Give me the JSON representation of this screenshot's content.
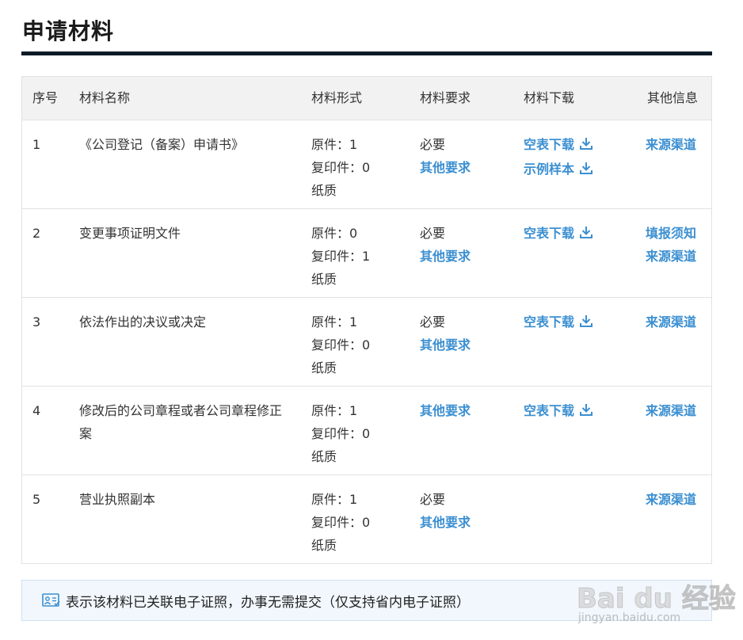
{
  "page": {
    "title": "申请材料"
  },
  "table": {
    "headers": {
      "no": "序号",
      "name": "材料名称",
      "form": "材料形式",
      "req": "材料要求",
      "download": "材料下载",
      "info": "其他信息"
    },
    "rows": [
      {
        "no": "1",
        "name": "《公司登记（备案）申请书》",
        "form": [
          "原件：1",
          "复印件：0",
          "纸质"
        ],
        "req_text": "必要",
        "req_link": "其他要求",
        "downloads": [
          "空表下载",
          "示例样本"
        ],
        "info_links": [
          "来源渠道"
        ]
      },
      {
        "no": "2",
        "name": "变更事项证明文件",
        "form": [
          "原件：0",
          "复印件：1",
          "纸质"
        ],
        "req_text": "必要",
        "req_link": "其他要求",
        "downloads": [
          "空表下载"
        ],
        "info_links": [
          "填报须知",
          "来源渠道"
        ]
      },
      {
        "no": "3",
        "name": "依法作出的决议或决定",
        "form": [
          "原件：1",
          "复印件：0",
          "纸质"
        ],
        "req_text": "必要",
        "req_link": "其他要求",
        "downloads": [
          "空表下载"
        ],
        "info_links": [
          "来源渠道"
        ]
      },
      {
        "no": "4",
        "name": "修改后的公司章程或者公司章程修正案",
        "form": [
          "原件：1",
          "复印件：0",
          "纸质"
        ],
        "req_text": "",
        "req_link": "其他要求",
        "downloads": [
          "空表下载"
        ],
        "info_links": [
          "来源渠道"
        ]
      },
      {
        "no": "5",
        "name": "营业执照副本",
        "form": [
          "原件：1",
          "复印件：0",
          "纸质"
        ],
        "req_text": "必要",
        "req_link": "其他要求",
        "downloads": [],
        "info_links": [
          "来源渠道"
        ]
      }
    ]
  },
  "legend": {
    "icon": "e-license-icon",
    "text": "表示该材料已关联电子证照，办事无需提交（仅支持省内电子证照）"
  },
  "watermark": {
    "brand": "Bai du 经验",
    "url": "jingyan.baidu.com"
  },
  "colors": {
    "link": "#3b8fd1",
    "rule": "#0b1a26",
    "header_bg": "#f2f2f2",
    "legend_bg": "#f1f7fd"
  }
}
